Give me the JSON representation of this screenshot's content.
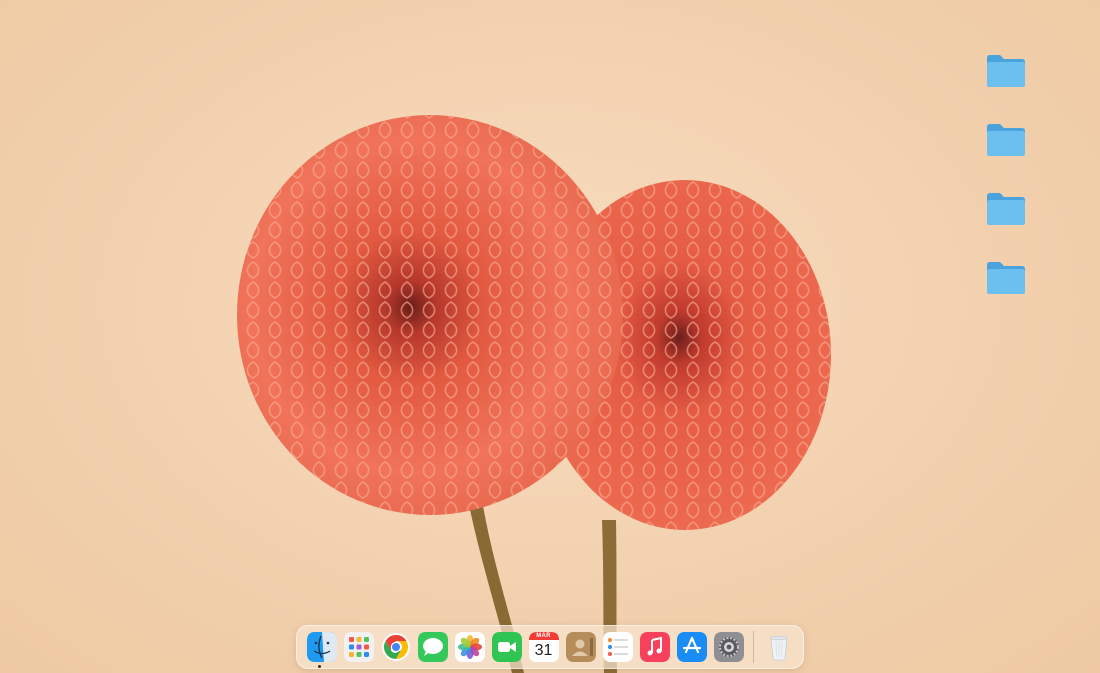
{
  "desktop": {
    "folders": [
      {
        "icon": "folder-icon"
      },
      {
        "icon": "folder-icon"
      },
      {
        "icon": "folder-icon"
      },
      {
        "icon": "folder-icon"
      }
    ]
  },
  "dock": {
    "apps": [
      {
        "icon": "finder-icon",
        "running": true
      },
      {
        "icon": "launchpad-icon"
      },
      {
        "icon": "chrome-icon"
      },
      {
        "icon": "messages-icon"
      },
      {
        "icon": "photos-icon"
      },
      {
        "icon": "facetime-icon"
      },
      {
        "icon": "calendar-icon",
        "month": "MAR",
        "day": "31"
      },
      {
        "icon": "contacts-icon"
      },
      {
        "icon": "reminders-icon"
      },
      {
        "icon": "music-icon"
      },
      {
        "icon": "app-store-icon"
      },
      {
        "icon": "system-settings-icon"
      },
      {
        "icon": "trash-icon"
      }
    ]
  },
  "colors": {
    "wallpaper": "#f2d0ad",
    "flower": "#ee6a4c",
    "folder": "#5fb4ea"
  }
}
